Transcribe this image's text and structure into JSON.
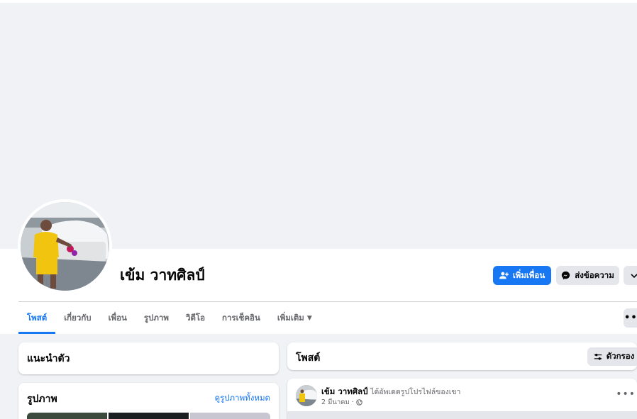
{
  "profile": {
    "name": "เข้ม วาทศิลป์"
  },
  "actions": {
    "add_friend": "เพิ่มเพื่อน",
    "message": "ส่งข้อความ"
  },
  "tabs": [
    {
      "label": "โพสต์",
      "active": true
    },
    {
      "label": "เกี่ยวกับ",
      "active": false
    },
    {
      "label": "เพื่อน",
      "active": false
    },
    {
      "label": "รูปภาพ",
      "active": false
    },
    {
      "label": "วิดีโอ",
      "active": false
    },
    {
      "label": "การเช็คอิน",
      "active": false
    },
    {
      "label": "เพิ่มเติม",
      "active": false
    }
  ],
  "intro": {
    "title": "แนะนำตัว"
  },
  "photos": {
    "title": "รูปภาพ",
    "see_all": "ดูรูปภาพทั้งหมด"
  },
  "posts": {
    "title": "โพสต์",
    "filter": "ตัวกรอง"
  },
  "post": {
    "author": "เข้ม วาทศิลป์",
    "action": "ได้อัพเดตรูปโปรไฟล์ของเขา",
    "date": "2 มีนาคม",
    "separator": "·",
    "privacy_icon": "globe-icon"
  },
  "colors": {
    "accent": "#1877f2",
    "secondary_button": "#e4e6eb",
    "background": "#f0f2f5",
    "text_secondary": "#65676b"
  }
}
